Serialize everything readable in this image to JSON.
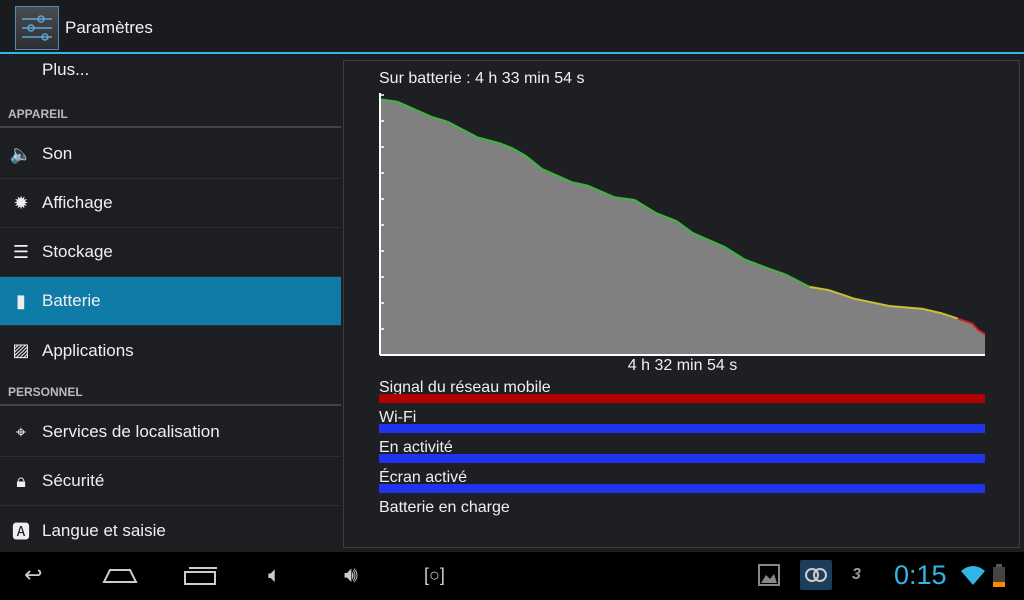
{
  "header": {
    "title": "Paramètres",
    "icon": "settings-sliders-icon"
  },
  "sidebar": {
    "top_item": "Plus...",
    "sections": [
      {
        "label": "APPAREIL"
      },
      {
        "label": "PERSONNEL"
      }
    ],
    "items": [
      {
        "label": "Son",
        "icon": "speaker-icon"
      },
      {
        "label": "Affichage",
        "icon": "brightness-icon"
      },
      {
        "label": "Stockage",
        "icon": "storage-icon"
      },
      {
        "label": "Batterie",
        "icon": "battery-icon",
        "selected": true
      },
      {
        "label": "Applications",
        "icon": "applications-icon"
      },
      {
        "label": "Services de localisation",
        "icon": "location-icon"
      },
      {
        "label": "Sécurité",
        "icon": "lock-icon"
      },
      {
        "label": "Langue et saisie",
        "icon": "language-icon"
      }
    ]
  },
  "battery": {
    "on_battery": "Sur batterie : 4 h 33 min 54 s",
    "duration_label": "4 h 32 min 54 s",
    "rows": [
      {
        "label": "Signal du réseau mobile",
        "color": "#b00000",
        "fill": 1
      },
      {
        "label": "Wi-Fi",
        "color": "#2233ee",
        "fill": 1
      },
      {
        "label": "En activité",
        "color": "#2233ee",
        "fill": 1
      },
      {
        "label": "Écran activé",
        "color": "#2233ee",
        "fill": 1
      },
      {
        "label": "Batterie en charge",
        "color": "#2233ee",
        "fill": 0
      }
    ]
  },
  "chart_data": {
    "type": "area",
    "ylim": [
      0,
      100
    ],
    "xlabel": "4 h 32 min 54 s",
    "x_unit": "fraction of elapsed time",
    "y_unit": "battery %",
    "colors": {
      "high": "#3cb83c",
      "mid": "#c8c030",
      "low": "#d02020",
      "fill": "#808080"
    },
    "points": [
      [
        0,
        98.3
      ],
      [
        2.9,
        97.4
      ],
      [
        8.5,
        91.6
      ],
      [
        11.2,
        89.7
      ],
      [
        16.1,
        83.7
      ],
      [
        19.8,
        81.4
      ],
      [
        21.8,
        79.6
      ],
      [
        24.1,
        76.6
      ],
      [
        26.8,
        71.5
      ],
      [
        31.8,
        66.4
      ],
      [
        34.4,
        65.1
      ],
      [
        38.7,
        60.7
      ],
      [
        42.1,
        59.6
      ],
      [
        45.7,
        54.5
      ],
      [
        49.0,
        51.5
      ],
      [
        51.7,
        46.9
      ],
      [
        57.0,
        41.5
      ],
      [
        60.3,
        36.7
      ],
      [
        64.3,
        33.2
      ],
      [
        67.0,
        31.0
      ],
      [
        71.0,
        26.2
      ],
      [
        74.3,
        24.9
      ],
      [
        78.3,
        21.7
      ],
      [
        84.3,
        18.8
      ],
      [
        89.6,
        17.8
      ],
      [
        92.9,
        16.0
      ],
      [
        95.5,
        14.0
      ],
      [
        97.9,
        12.1
      ],
      [
        98.9,
        9.6
      ],
      [
        100,
        8.0
      ]
    ]
  },
  "statusbar": {
    "time": "0:15",
    "icons": [
      "gallery-icon",
      "media-app-icon",
      "3d-app-icon",
      "wifi-icon",
      "battery-low-icon"
    ]
  },
  "navbar": {
    "icons": [
      "back-icon",
      "home-icon",
      "recent-apps-icon",
      "volume-down-icon",
      "volume-up-icon",
      "screenshot-icon"
    ]
  }
}
